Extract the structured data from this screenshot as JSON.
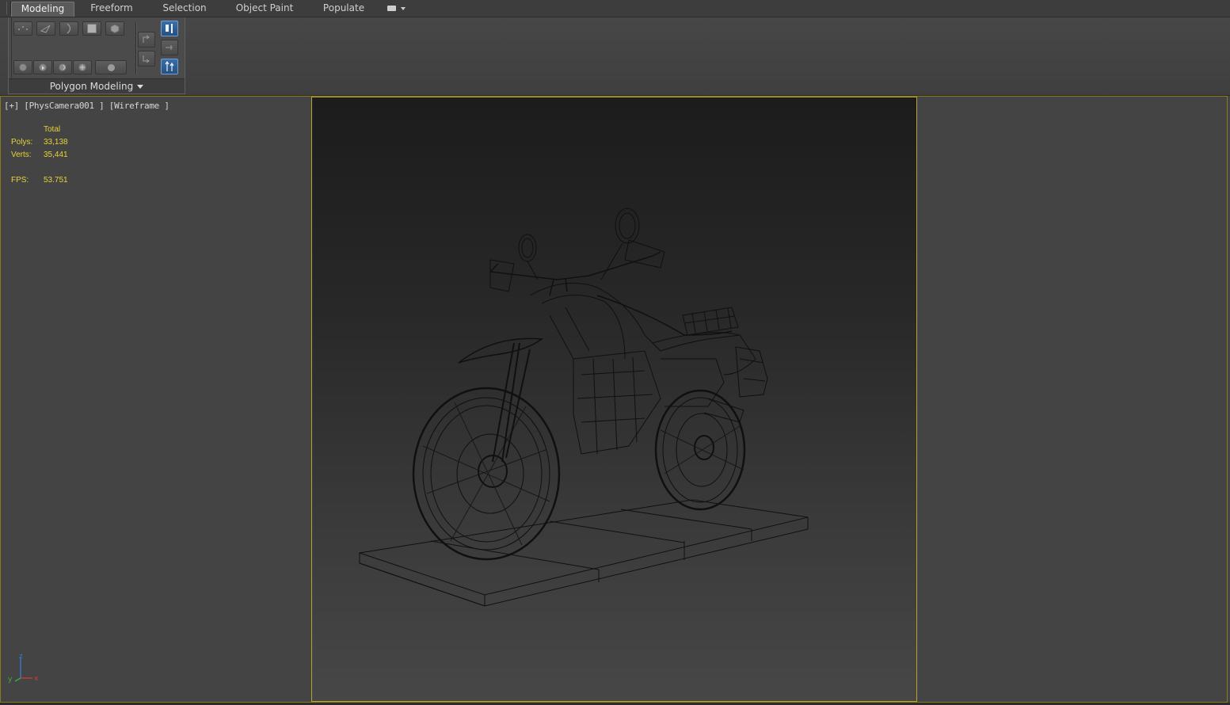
{
  "ribbon": {
    "tabs": [
      "Modeling",
      "Freeform",
      "Selection",
      "Object Paint",
      "Populate"
    ],
    "active_tab": "Modeling",
    "panel_label": "Polygon Modeling"
  },
  "viewport": {
    "label": "[+] [PhysCamera001 ] [Wireframe ]",
    "stats": {
      "header": "Total",
      "polys_label": "Polys:",
      "polys_value": "33,138",
      "verts_label": "Verts:",
      "verts_value": "35,441",
      "fps_label": "FPS:",
      "fps_value": "53.751"
    },
    "axis": {
      "z": "z",
      "y": "y",
      "x": "x"
    }
  },
  "colors": {
    "accent_active_frame": "#b9a42a",
    "stats_text": "#e8d23a",
    "toggle_blue": "#3a6ea8"
  }
}
